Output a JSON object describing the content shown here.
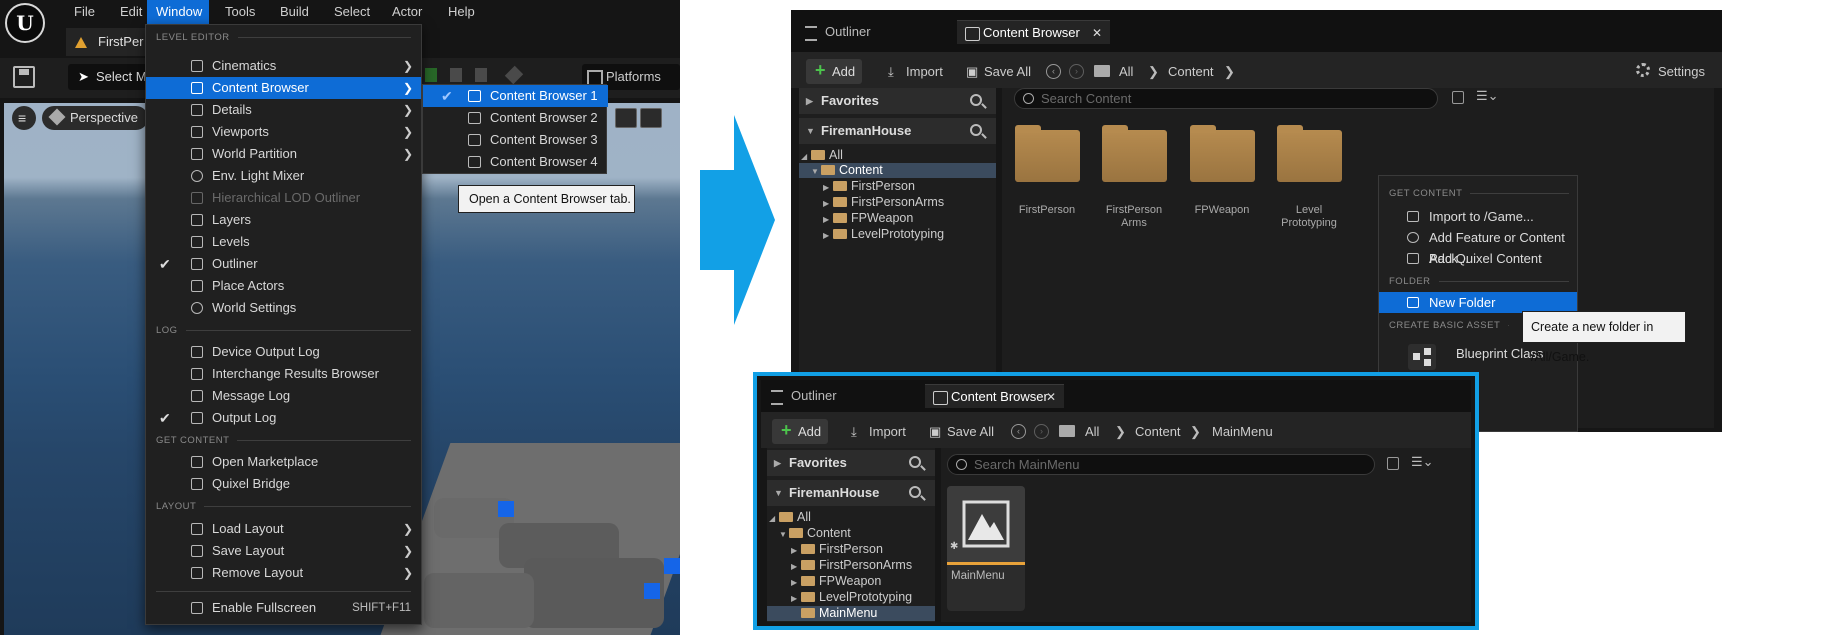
{
  "editor": {
    "logo_text": "U",
    "menubar": [
      "File",
      "Edit",
      "Window",
      "Tools",
      "Build",
      "Select",
      "Actor",
      "Help"
    ],
    "active_menu": "Window",
    "doc_tab": "FirstPer",
    "select_mode": "Select M",
    "platforms": "Platforms",
    "viewport_mode": "Perspective"
  },
  "window_menu": {
    "sections": {
      "level_editor": "LEVEL EDITOR",
      "log": "LOG",
      "get_content": "GET CONTENT",
      "layout": "LAYOUT"
    },
    "items": {
      "cinematics": "Cinematics",
      "content_browser": "Content Browser",
      "details": "Details",
      "viewports": "Viewports",
      "world_partition": "World Partition",
      "env_light_mixer": "Env. Light Mixer",
      "hlod_outliner": "Hierarchical LOD Outliner",
      "layers": "Layers",
      "levels": "Levels",
      "outliner": "Outliner",
      "place_actors": "Place Actors",
      "world_settings": "World Settings",
      "device_output_log": "Device Output Log",
      "interchange_results": "Interchange Results Browser",
      "message_log": "Message Log",
      "output_log": "Output Log",
      "open_marketplace": "Open Marketplace",
      "quixel_bridge": "Quixel Bridge",
      "load_layout": "Load Layout",
      "save_layout": "Save Layout",
      "remove_layout": "Remove Layout",
      "enable_fullscreen": "Enable Fullscreen",
      "fullscreen_shortcut": "SHIFT+F11"
    },
    "submenu": [
      "Content Browser 1",
      "Content Browser 2",
      "Content Browser 3",
      "Content Browser 4"
    ],
    "tooltip": "Open a Content Browser tab."
  },
  "cb1": {
    "tabs": {
      "outliner": "Outliner",
      "content_browser": "Content Browser"
    },
    "toolbar": {
      "add": "Add",
      "import": "Import",
      "save_all": "Save All",
      "settings": "Settings"
    },
    "breadcrumb": [
      "All",
      "Content"
    ],
    "favorites": "Favorites",
    "project": "FiremanHouse",
    "search_placeholder": "Search Content",
    "tree": [
      "All",
      "Content",
      "FirstPerson",
      "FirstPersonArms",
      "FPWeapon",
      "LevelPrototyping"
    ],
    "folders": [
      "FirstPerson",
      "FirstPerson Arms",
      "FPWeapon",
      "Level Prototyping"
    ]
  },
  "context_menu": {
    "sections": {
      "get_content": "GET CONTENT",
      "folder": "FOLDER",
      "create_basic_asset": "CREATE BASIC ASSET"
    },
    "items": {
      "import_to": "Import to /Game...",
      "add_feature": "Add Feature or Content Pack...",
      "add_quixel": "Add Quixel Content",
      "new_folder": "New Folder",
      "blueprint_class": "Blueprint Class"
    },
    "tooltip": "Create a new folder in /All/Game."
  },
  "cb2": {
    "tabs": {
      "outliner": "Outliner",
      "content_browser": "Content Browser"
    },
    "toolbar": {
      "add": "Add",
      "import": "Import",
      "save_all": "Save All"
    },
    "breadcrumb": [
      "All",
      "Content",
      "MainMenu"
    ],
    "favorites": "Favorites",
    "project": "FiremanHouse",
    "search_placeholder": "Search MainMenu",
    "tree": [
      "All",
      "Content",
      "FirstPerson",
      "FirstPersonArms",
      "FPWeapon",
      "LevelPrototyping",
      "MainMenu"
    ],
    "asset": "MainMenu"
  },
  "colors": {
    "accent": "#0e6cd6",
    "highlight_frame": "#12a0e6",
    "arrow": "#12a0e6",
    "folder": "#b68b4f"
  }
}
